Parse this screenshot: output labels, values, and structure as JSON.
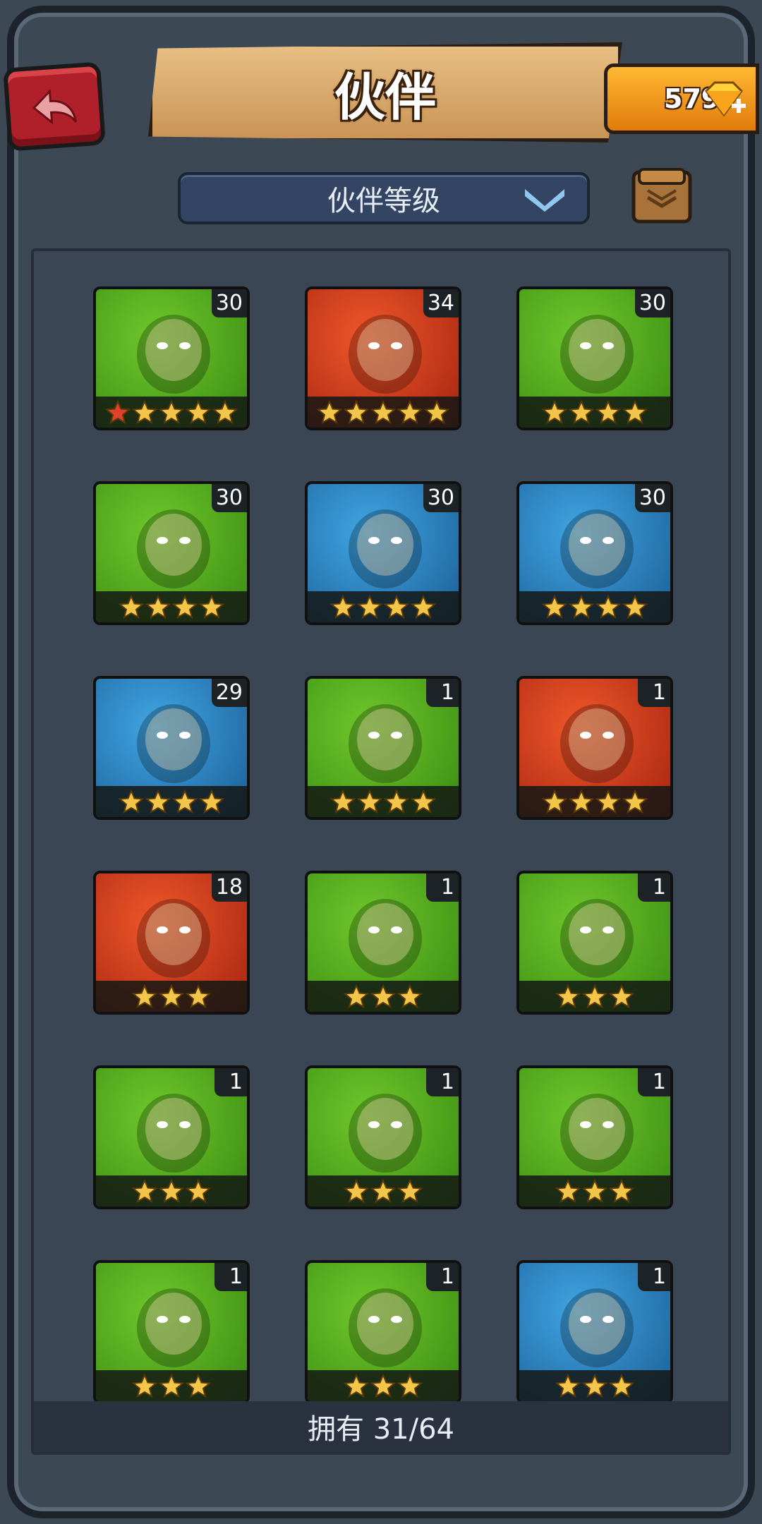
{
  "header": {
    "title": "伙伴",
    "gems": "579"
  },
  "sort": {
    "label": "伙伴等级"
  },
  "footer": {
    "owned": "拥有 31/64"
  },
  "colors": {
    "green": "#4aa61c",
    "red": "#d7421a",
    "blue": "#2687c8",
    "star_gold": "#f3c548",
    "star_red": "#e2402a"
  },
  "partners": [
    {
      "level": "30",
      "stars": 5,
      "red_stars": 1,
      "bg": "green"
    },
    {
      "level": "34",
      "stars": 5,
      "red_stars": 0,
      "bg": "red"
    },
    {
      "level": "30",
      "stars": 4,
      "red_stars": 0,
      "bg": "green"
    },
    {
      "level": "30",
      "stars": 4,
      "red_stars": 0,
      "bg": "green"
    },
    {
      "level": "30",
      "stars": 4,
      "red_stars": 0,
      "bg": "blue"
    },
    {
      "level": "30",
      "stars": 4,
      "red_stars": 0,
      "bg": "blue"
    },
    {
      "level": "29",
      "stars": 4,
      "red_stars": 0,
      "bg": "blue"
    },
    {
      "level": "1",
      "stars": 4,
      "red_stars": 0,
      "bg": "green"
    },
    {
      "level": "1",
      "stars": 4,
      "red_stars": 0,
      "bg": "red"
    },
    {
      "level": "18",
      "stars": 3,
      "red_stars": 0,
      "bg": "red"
    },
    {
      "level": "1",
      "stars": 3,
      "red_stars": 0,
      "bg": "green"
    },
    {
      "level": "1",
      "stars": 3,
      "red_stars": 0,
      "bg": "green"
    },
    {
      "level": "1",
      "stars": 3,
      "red_stars": 0,
      "bg": "green"
    },
    {
      "level": "1",
      "stars": 3,
      "red_stars": 0,
      "bg": "green"
    },
    {
      "level": "1",
      "stars": 3,
      "red_stars": 0,
      "bg": "green"
    },
    {
      "level": "1",
      "stars": 3,
      "red_stars": 0,
      "bg": "green"
    },
    {
      "level": "1",
      "stars": 3,
      "red_stars": 0,
      "bg": "green"
    },
    {
      "level": "1",
      "stars": 3,
      "red_stars": 0,
      "bg": "blue"
    }
  ]
}
